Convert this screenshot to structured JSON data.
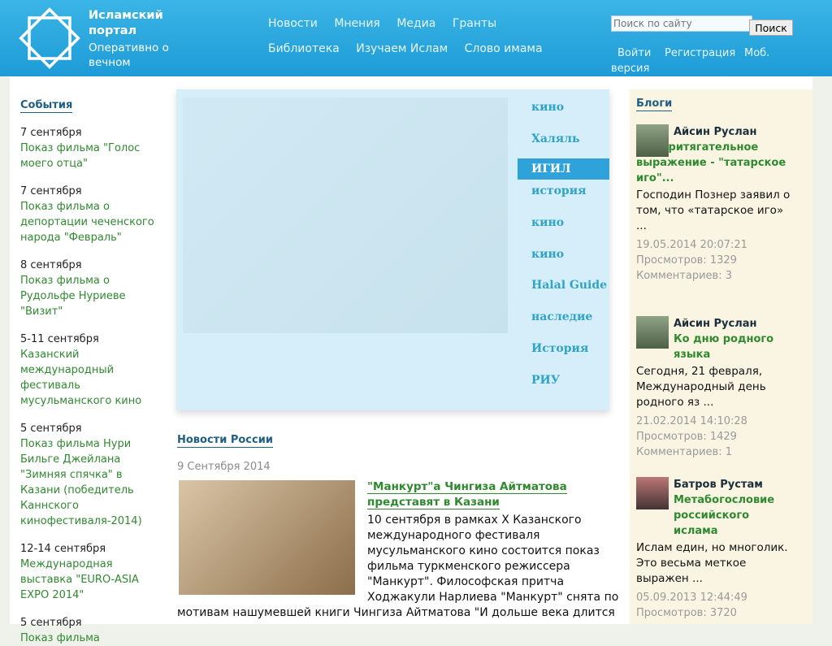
{
  "header": {
    "title": "Исламский портал",
    "subtitle": "Оперативно о вечном",
    "nav_row1": [
      "Новости",
      "Мнения",
      "Медиа",
      "Гранты"
    ],
    "nav_row2": [
      "Библиотека",
      "Изучаем Ислам",
      "Слово имама"
    ],
    "search_placeholder": "Поиск по сайту",
    "search_button": "Поиск",
    "login": "Войти",
    "register": "Регистрация",
    "mobile": "Моб.",
    "mobile2": "версия"
  },
  "events": {
    "title": "События",
    "items": [
      {
        "date": "7 сентября",
        "title": "Показ фильма \"Голос моего отца\""
      },
      {
        "date": "7 сентября",
        "title": "Показ фильма о депортации чеченского народа \"Февраль\""
      },
      {
        "date": "8 сентября",
        "title": "Показ фильма о Рудольфе Нуриеве \"Визит\""
      },
      {
        "date": "5-11 сентября",
        "title": "Казанский международный фестиваль мусульманского кино"
      },
      {
        "date": "5 сентября",
        "title": "Показ фильма Нури Бильге Джейлана \"Зимняя спячка\" в Казани (победитель Каннского кинофестиваля-2014)"
      },
      {
        "date": "12-14 сентября",
        "title": "Международная выставка \"EURO-ASIA EXPO 2014\""
      },
      {
        "date": "5 сентября",
        "title": "Показ фильма"
      }
    ]
  },
  "slider": {
    "tags": [
      "кино",
      "Халяль",
      "ИГИЛ",
      "история",
      "кино",
      "кино",
      "Halal Guide",
      "наследие",
      "История",
      "РИУ"
    ],
    "active_index": 2
  },
  "news": {
    "section": "Новости России",
    "date": "9 Сентября 2014",
    "title": "\"Манкурт\"а Чингиза Айтматова представят в Казани",
    "text": "10 сентября в рамках X Казанского международного фестиваля мусульманского кино состоится показ фильма туркменского режиссера \"Манкурт\". Философская притча Ходжакули Нарлиева \"Манкурт\" снята по",
    "text2": "мотивам нашумевшей книги Чингиза Айтматова \"И дольше века длится"
  },
  "blogs": {
    "title": "Блоги",
    "posts": [
      {
        "author": "Айсин Руслан",
        "title": "Это притягательное выражение - \"татарское иго\"...",
        "excerpt": "Господин Познер заявил о том, что «татарское иго» ...",
        "date": "19.05.2014 20:07:21",
        "views": "Просмотров: 1329",
        "comments": "Комментариев: 3"
      },
      {
        "author": "Айсин Руслан",
        "title": "Ко дню родного языка",
        "excerpt": "Сегодня, 21 февраля, Международный день родного яз ...",
        "date": "21.02.2014 14:10:28",
        "views": "Просмотров: 1429",
        "comments": "Комментариев: 1"
      },
      {
        "author": "Батров Рустам",
        "title": "Метабогословие российского ислама",
        "excerpt": "Ислам един, но многолик. Это весьма меткое выражен ...",
        "date": "05.09.2013 12:44:49",
        "views": "Просмотров: 3720",
        "comments": ""
      }
    ]
  }
}
